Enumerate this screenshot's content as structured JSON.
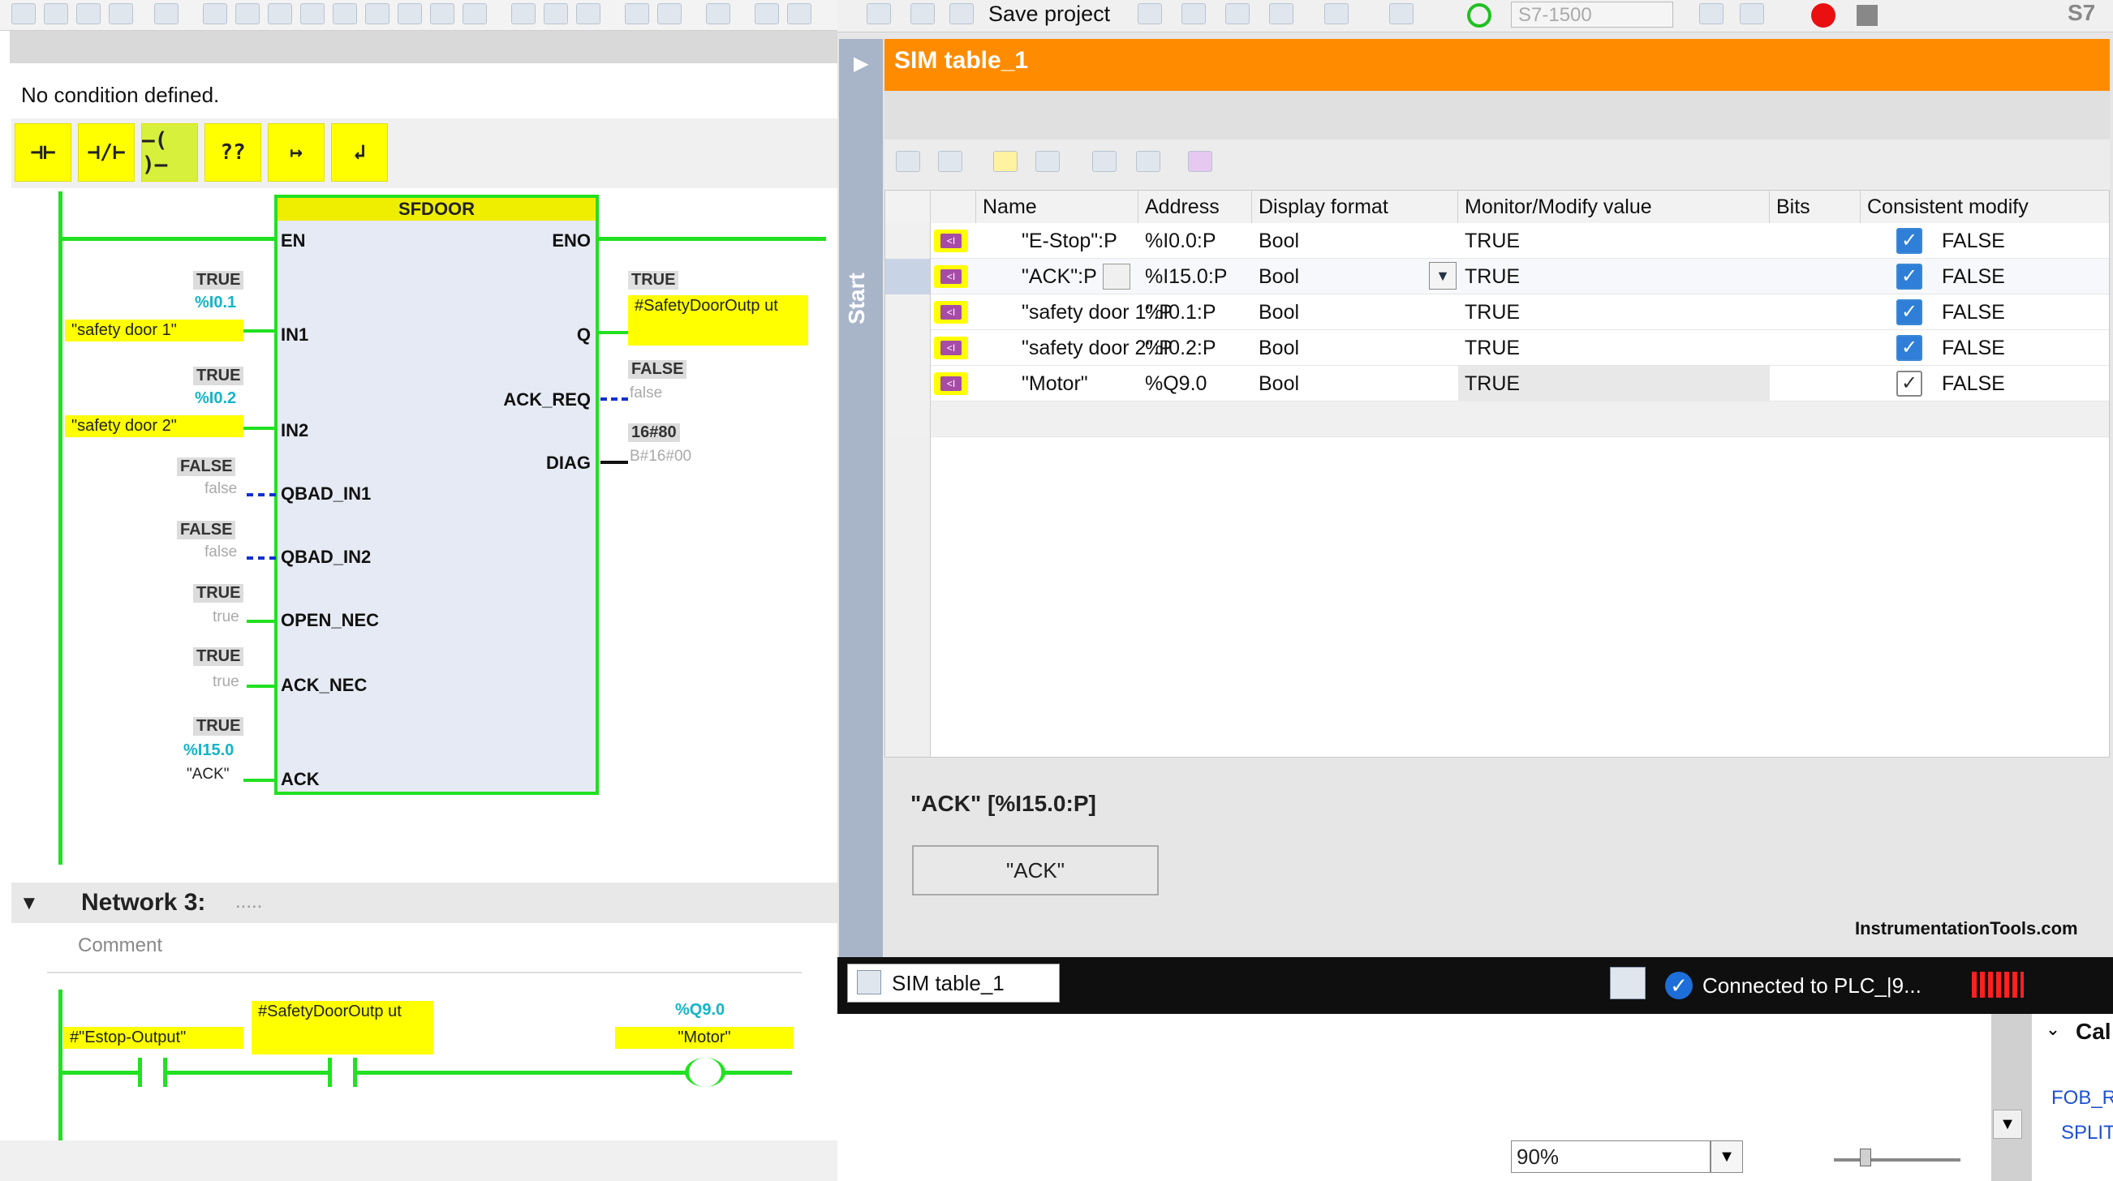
{
  "editor": {
    "condition_text": "No condition defined.",
    "instructions": [
      "⊣⊢",
      "⊣/⊢",
      "–( )–",
      "??",
      "↦",
      "↲"
    ],
    "block": {
      "title": "SFDOOR",
      "in_pins": [
        "EN",
        "IN1",
        "IN2",
        "QBAD_IN1",
        "QBAD_IN2",
        "OPEN_NEC",
        "ACK_NEC",
        "ACK"
      ],
      "out_pins": [
        "ENO",
        "Q",
        "ACK_REQ",
        "DIAG"
      ]
    },
    "in1": {
      "status": "TRUE",
      "address": "%I0.1",
      "tag": "\"safety door 1\""
    },
    "in2": {
      "status": "TRUE",
      "address": "%I0.2",
      "tag": "\"safety door 2\""
    },
    "qbad_in1": {
      "status": "FALSE",
      "value": "false"
    },
    "qbad_in2": {
      "status": "FALSE",
      "value": "false"
    },
    "open_nec": {
      "status": "TRUE",
      "value": "true"
    },
    "ack_nec": {
      "status": "TRUE",
      "value": "true"
    },
    "ack": {
      "status": "TRUE",
      "address": "%I15.0",
      "tag": "\"ACK\""
    },
    "q_out": {
      "status": "TRUE",
      "tag": "#SafetyDoorOutp ut"
    },
    "ack_req": {
      "status": "FALSE",
      "value": "false"
    },
    "diag": {
      "status": "16#80",
      "value": "B#16#00"
    },
    "network3": {
      "title": "Network 3:",
      "dots": ".....",
      "comment": "Comment",
      "contact1": "#\"Estop-Output\"",
      "contact2": "#SafetyDoorOutp ut",
      "coil_address": "%Q9.0",
      "coil_tag": "\"Motor\""
    }
  },
  "toolbar": {
    "save_label": "Save project",
    "cpu": "S7-1500",
    "brand": "S7"
  },
  "sim": {
    "title": "SIM table_1",
    "start_label": "Start",
    "columns": [
      "Name",
      "Address",
      "Display format",
      "Monitor/Modify value",
      "Bits",
      "Consistent modify"
    ],
    "rows": [
      {
        "name": "\"E-Stop\":P",
        "address": "%I0.0:P",
        "format": "Bool",
        "value": "TRUE",
        "bits": true,
        "consistent": "FALSE"
      },
      {
        "name": "\"ACK\":P",
        "address": "%I15.0:P",
        "format": "Bool",
        "value": "TRUE",
        "bits": true,
        "consistent": "FALSE"
      },
      {
        "name": "\"safety door 1\":P",
        "address": "%I0.1:P",
        "format": "Bool",
        "value": "TRUE",
        "bits": true,
        "consistent": "FALSE"
      },
      {
        "name": "\"safety door 2\":P",
        "address": "%I0.2:P",
        "format": "Bool",
        "value": "TRUE",
        "bits": true,
        "consistent": "FALSE"
      },
      {
        "name": "\"Motor\"",
        "address": "%Q9.0",
        "format": "Bool",
        "value": "TRUE",
        "bits": false,
        "consistent": "FALSE"
      }
    ],
    "detail_title": "\"ACK\" [%I15.0:P]",
    "detail_button": "\"ACK\"",
    "watermark": "InstrumentationTools.com"
  },
  "status": {
    "tab": "SIM table_1",
    "connection": "Connected to PLC_|9..."
  },
  "bottom": {
    "zoom": "90%",
    "fob": "FOB_R",
    "split": "SPLIT",
    "call": "Cal"
  },
  "colors": {
    "accent": "#ff8c00",
    "wire": "#22e022",
    "highlight": "#ffff00",
    "status_blue": "#1d6ed8"
  }
}
